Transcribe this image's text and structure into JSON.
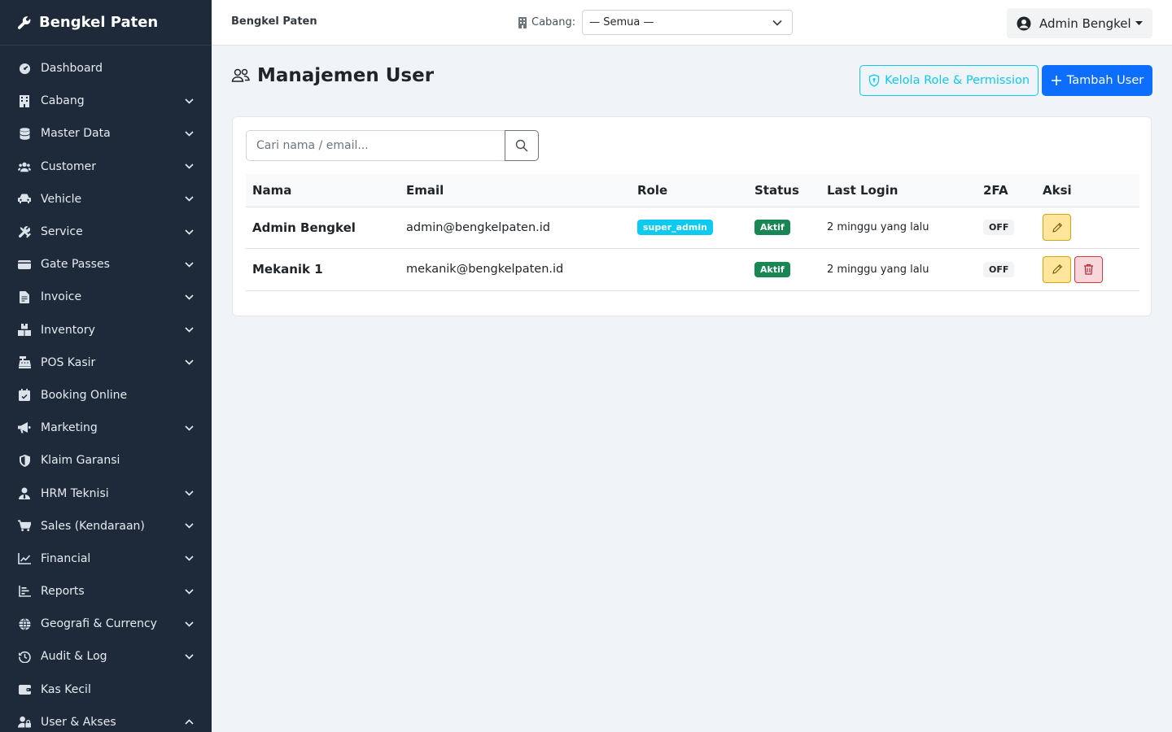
{
  "brand": {
    "name": "Bengkel Paten"
  },
  "sidebar": {
    "items": [
      {
        "label": "Dashboard",
        "icon": "gauge-icon",
        "expandable": false
      },
      {
        "label": "Cabang",
        "icon": "building-icon",
        "expandable": true
      },
      {
        "label": "Master Data",
        "icon": "database-icon",
        "expandable": true
      },
      {
        "label": "Customer",
        "icon": "users-icon",
        "expandable": true
      },
      {
        "label": "Vehicle",
        "icon": "car-icon",
        "expandable": true
      },
      {
        "label": "Service",
        "icon": "tools-icon",
        "expandable": true
      },
      {
        "label": "Gate Passes",
        "icon": "id-card-icon",
        "expandable": true
      },
      {
        "label": "Invoice",
        "icon": "file-invoice-icon",
        "expandable": true
      },
      {
        "label": "Inventory",
        "icon": "boxes-icon",
        "expandable": true
      },
      {
        "label": "POS Kasir",
        "icon": "cash-register-icon",
        "expandable": true
      },
      {
        "label": "Booking Online",
        "icon": "calendar-check-icon",
        "expandable": false
      },
      {
        "label": "Marketing",
        "icon": "bullhorn-icon",
        "expandable": true
      },
      {
        "label": "Klaim Garansi",
        "icon": "shield-icon",
        "expandable": false
      },
      {
        "label": "HRM Teknisi",
        "icon": "user-tie-icon",
        "expandable": true
      },
      {
        "label": "Sales (Kendaraan)",
        "icon": "cart-icon",
        "expandable": true
      },
      {
        "label": "Financial",
        "icon": "line-chart-icon",
        "expandable": true
      },
      {
        "label": "Reports",
        "icon": "bar-chart-icon",
        "expandable": true
      },
      {
        "label": "Geografi & Currency",
        "icon": "globe-icon",
        "expandable": true
      },
      {
        "label": "Audit & Log",
        "icon": "history-icon",
        "expandable": true
      },
      {
        "label": "Kas Kecil",
        "icon": "wallet-icon",
        "expandable": false
      },
      {
        "label": "User & Akses",
        "icon": "user-lock-icon",
        "expandable": true,
        "expanded": true
      }
    ]
  },
  "topbar": {
    "title": "Bengkel Paten",
    "branch_label": "Cabang:",
    "branch_value": "— Semua —",
    "user_name": "Admin Bengkel"
  },
  "page": {
    "title": "Manajemen User",
    "role_button": "Kelola Role & Permission",
    "add_button": "Tambah User",
    "search_placeholder": "Cari nama / email..."
  },
  "table": {
    "headers": {
      "name": "Nama",
      "email": "Email",
      "role": "Role",
      "status": "Status",
      "last_login": "Last Login",
      "twofa": "2FA",
      "actions": "Aksi"
    },
    "rows": [
      {
        "name": "Admin Bengkel",
        "email": "admin@bengkelpaten.id",
        "role": "super_admin",
        "status": "Aktif",
        "last_login": "2 minggu yang lalu",
        "twofa": "OFF",
        "can_delete": false
      },
      {
        "name": "Mekanik 1",
        "email": "mekanik@bengkelpaten.id",
        "role": "",
        "status": "Aktif",
        "last_login": "2 minggu yang lalu",
        "twofa": "OFF",
        "can_delete": true
      }
    ]
  },
  "colors": {
    "sidebar_bg": "#1e2a3a",
    "primary": "#0d6efd",
    "info": "#0dcaf0",
    "success": "#198754",
    "warning": "#ffe69c",
    "danger": "#dc3545"
  }
}
